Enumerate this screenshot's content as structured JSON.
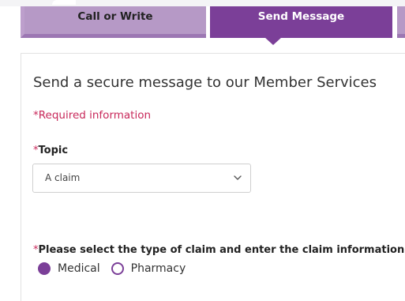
{
  "tabs": {
    "call_or_write": "Call or Write",
    "send_message": "Send Message"
  },
  "form": {
    "heading": "Send a secure message to our Member Services",
    "required_note": "*Required information",
    "required_marker": "*",
    "topic": {
      "label": "Topic",
      "selected": "A claim"
    },
    "claim_type": {
      "label": "Please select the type of claim and enter the claim information:",
      "options": [
        {
          "label": "Medical",
          "checked": true
        },
        {
          "label": "Pharmacy",
          "checked": false
        }
      ]
    }
  },
  "colors": {
    "accent": "#7b3f98",
    "tab_inactive": "#b699c6",
    "required": "#c8285a"
  },
  "icons": {
    "select_arrow": "chevron-down-icon"
  }
}
